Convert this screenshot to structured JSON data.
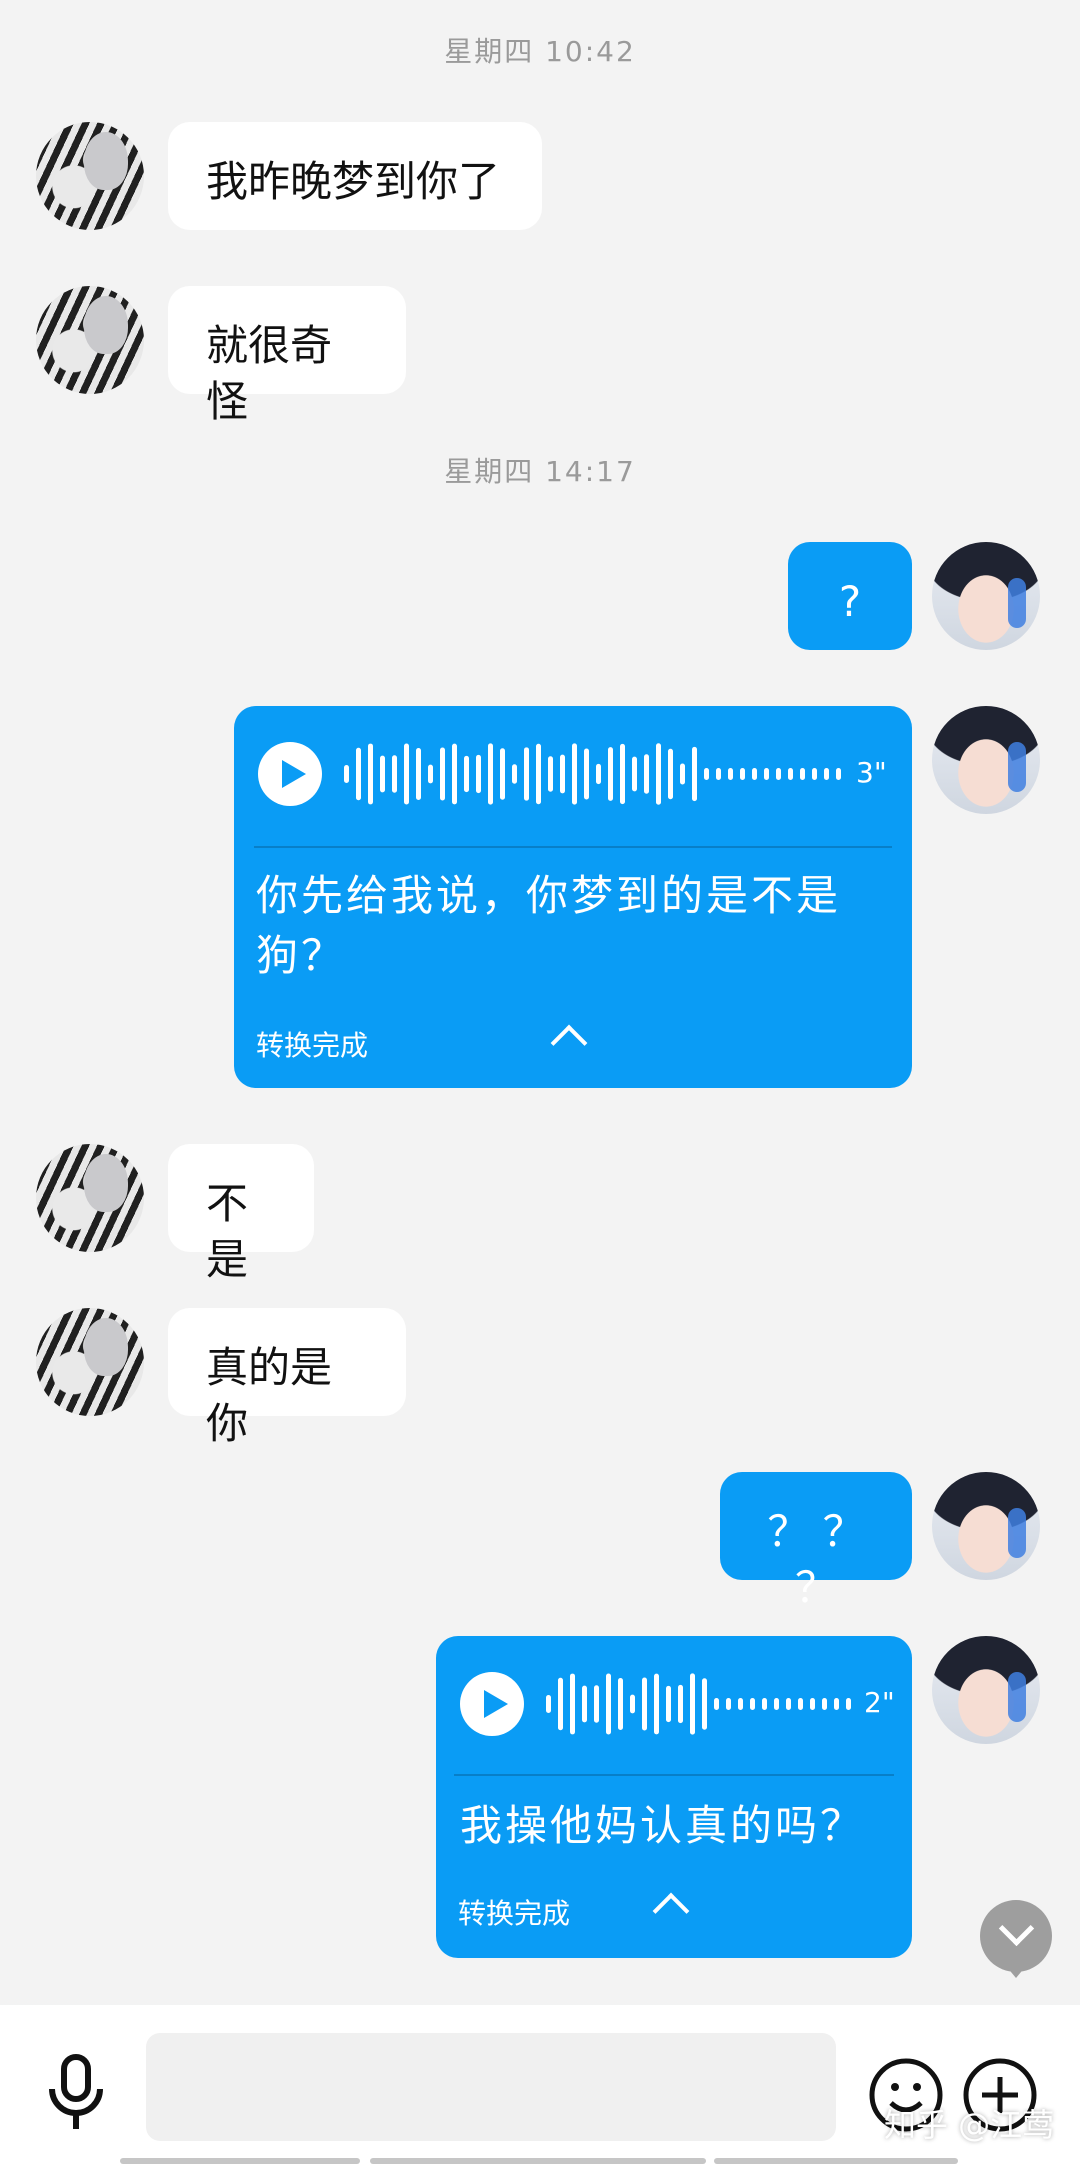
{
  "timestamps": [
    "星期四 10:42",
    "星期四 14:17"
  ],
  "messages": {
    "m1": "我昨晚梦到你了",
    "m2": "就很奇怪",
    "m3": "?",
    "m5": "不是",
    "m6": "真的是你",
    "m7": "？ ？ ？"
  },
  "voice1": {
    "duration": "3\"",
    "transcript_line1": "你先给我说，你梦到的是不是",
    "transcript_line2": "狗？",
    "status": "转换完成"
  },
  "voice2": {
    "duration": "2\"",
    "transcript": "我操他妈认真的吗？",
    "status": "转换完成"
  },
  "input": {
    "value": "",
    "placeholder": ""
  },
  "watermark": "知乎 @江莺",
  "colors": {
    "bubble_out": "#0a9cf5",
    "bubble_in": "#ffffff",
    "background": "#f3f3f3"
  },
  "icons": [
    "microphone-icon",
    "emoji-icon",
    "plus-circle-icon",
    "chevron-down-icon",
    "play-icon",
    "caret-up-icon"
  ]
}
